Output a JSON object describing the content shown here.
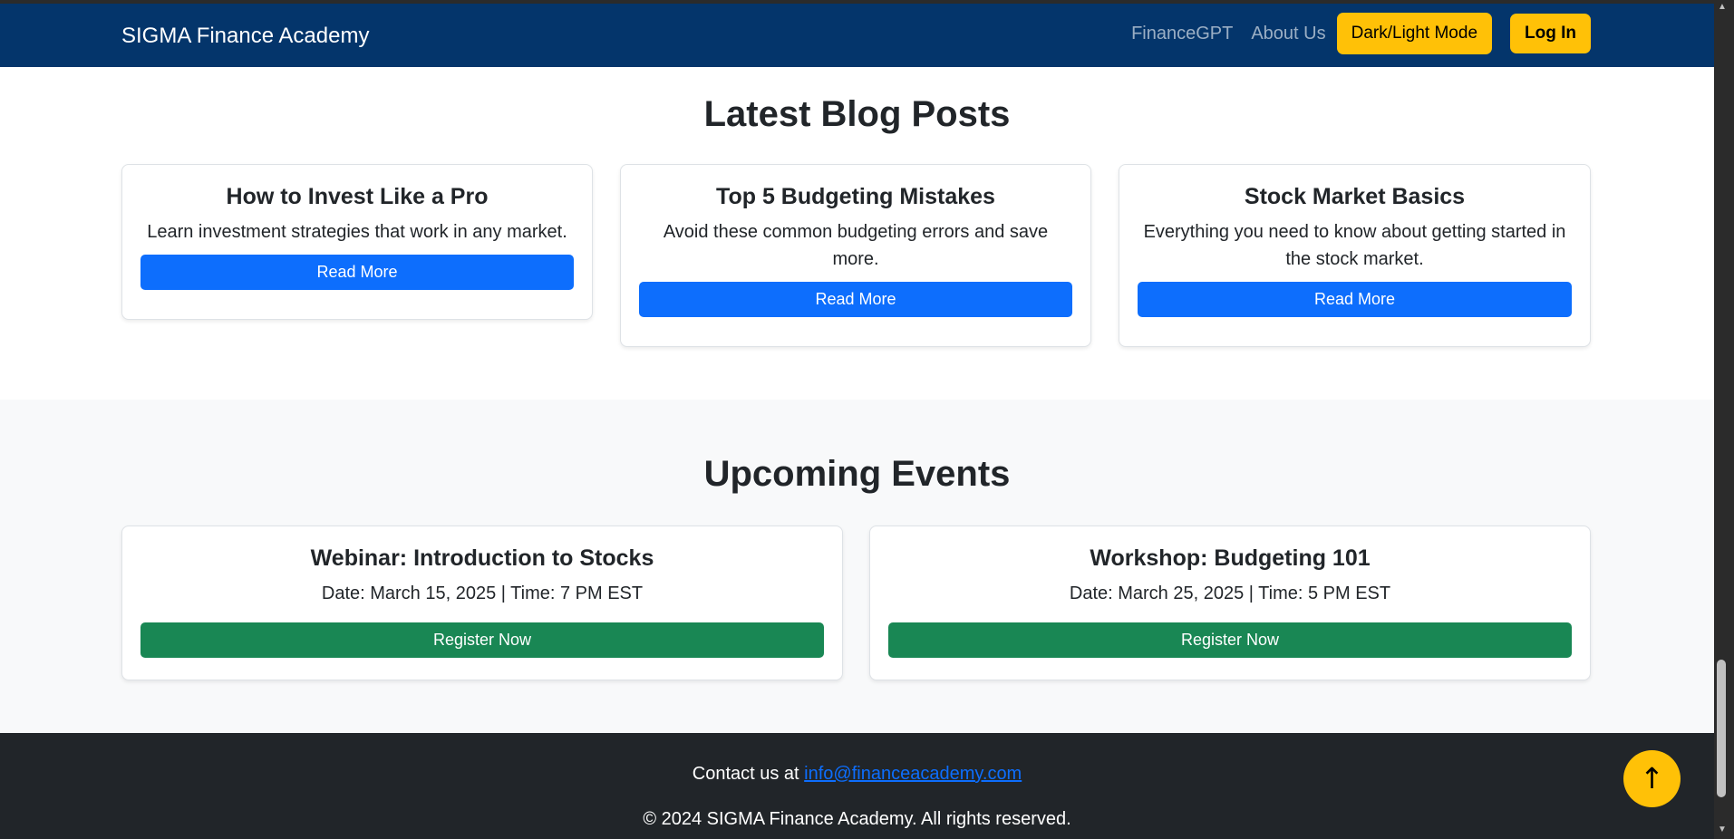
{
  "navbar": {
    "brand": "SIGMA Finance Academy",
    "links": [
      "FinanceGPT",
      "About Us"
    ],
    "mode_button": "Dark/Light Mode",
    "login_button": "Log In"
  },
  "blog": {
    "title": "Latest Blog Posts",
    "posts": [
      {
        "title": "How to Invest Like a Pro",
        "text": "Learn investment strategies that work in any market.",
        "button": "Read More"
      },
      {
        "title": "Top 5 Budgeting Mistakes",
        "text": "Avoid these common budgeting errors and save more.",
        "button": "Read More"
      },
      {
        "title": "Stock Market Basics",
        "text": "Everything you need to know about getting started in the stock market.",
        "button": "Read More"
      }
    ]
  },
  "events": {
    "title": "Upcoming Events",
    "items": [
      {
        "title": "Webinar: Introduction to Stocks",
        "text": "Date: March 15, 2025 | Time: 7 PM EST",
        "button": "Register Now"
      },
      {
        "title": "Workshop: Budgeting 101",
        "text": "Date: March 25, 2025 | Time: 5 PM EST",
        "button": "Register Now"
      }
    ]
  },
  "footer": {
    "contact_prefix": "Contact us at ",
    "email": "info@financeacademy.com",
    "copyright": "© 2024 SIGMA Finance Academy. All rights reserved."
  },
  "scroll_top": {
    "icon": "arrow-up-icon",
    "glyph": "↑"
  },
  "colors": {
    "navbar": "#04356b",
    "accent_yellow": "#ffc107",
    "primary_blue": "#0d6efd",
    "success_green": "#198754",
    "footer": "#212529",
    "events_bg": "#f8f9fa"
  }
}
